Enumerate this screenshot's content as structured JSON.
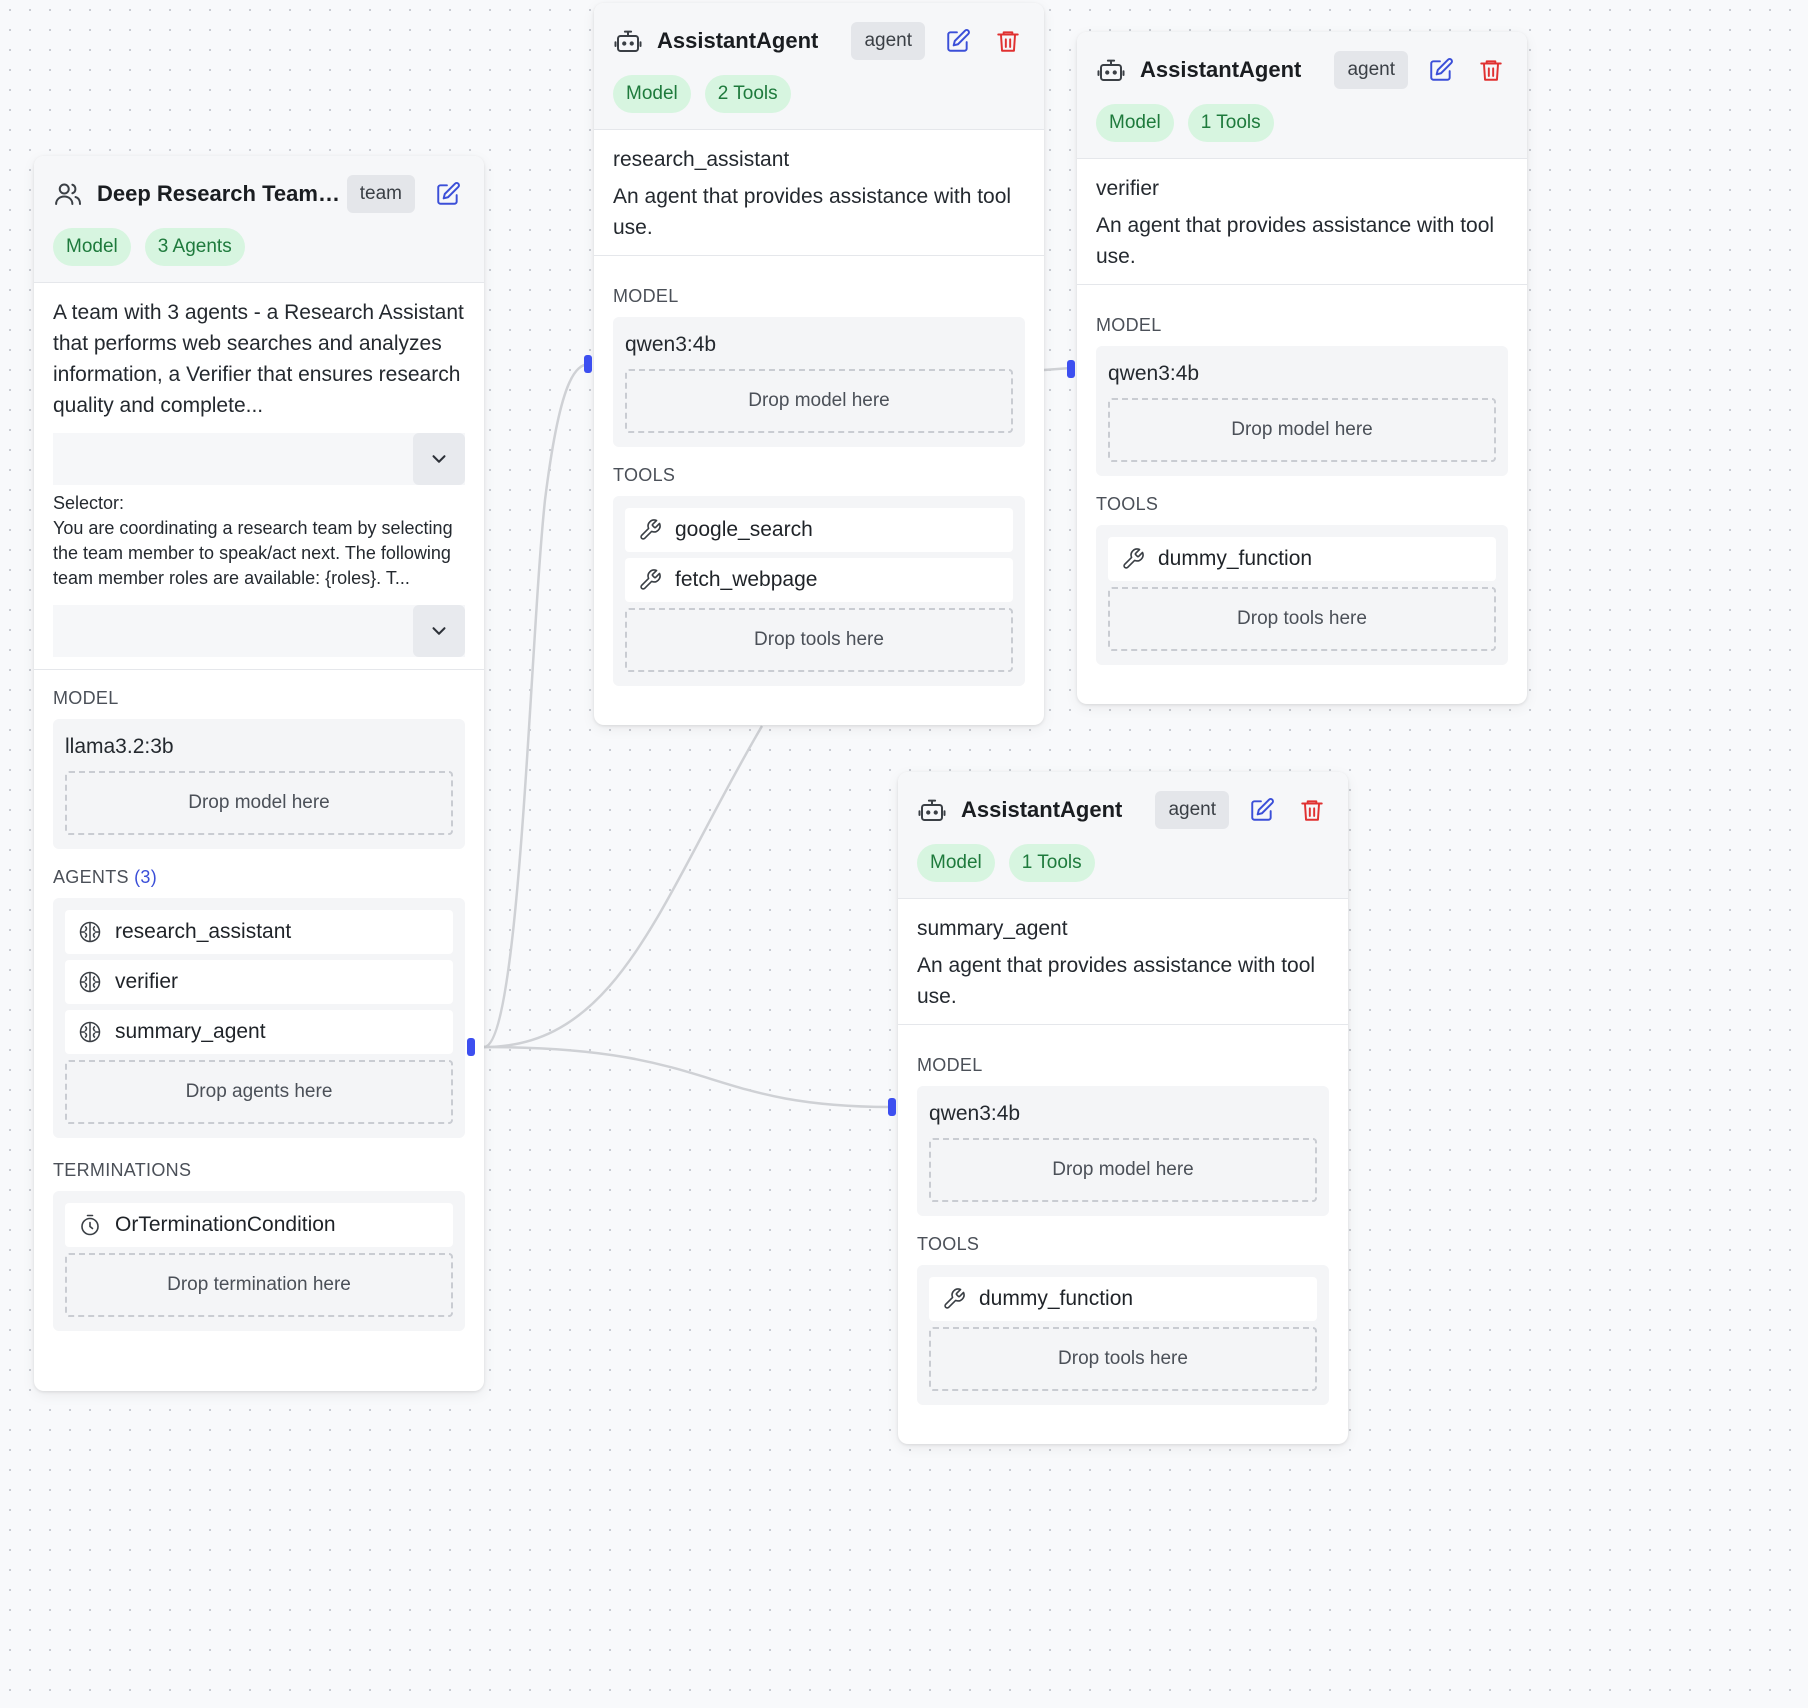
{
  "team": {
    "title": "Deep Research Team_...",
    "type_badge": "team",
    "pills": [
      "Model",
      "3 Agents"
    ],
    "description": "A team with 3 agents - a Research Assistant that performs web searches and analyzes information, a Verifier that ensures research quality and complete...",
    "selector_label": "Selector:",
    "selector_text": "You are coordinating a research team by selecting the team member to speak/act next. The following team member roles are available: {roles}. T...",
    "model_label": "MODEL",
    "model_value": "llama3.2:3b",
    "drop_model": "Drop model here",
    "agents_label": "AGENTS",
    "agents_count": "(3)",
    "agents": [
      "research_assistant",
      "verifier",
      "summary_agent"
    ],
    "drop_agents": "Drop agents here",
    "terminations_label": "TERMINATIONS",
    "termination": "OrTerminationCondition",
    "drop_termination": "Drop termination here"
  },
  "agent1": {
    "title": "AssistantAgent",
    "type_badge": "agent",
    "pills": [
      "Model",
      "2 Tools"
    ],
    "name": "research_assistant",
    "description": "An agent that provides assistance with tool use.",
    "model_label": "MODEL",
    "model_value": "qwen3:4b",
    "drop_model": "Drop model here",
    "tools_label": "TOOLS",
    "tools": [
      "google_search",
      "fetch_webpage"
    ],
    "drop_tools": "Drop tools here"
  },
  "agent2": {
    "title": "AssistantAgent",
    "type_badge": "agent",
    "pills": [
      "Model",
      "1 Tools"
    ],
    "name": "verifier",
    "description": "An agent that provides assistance with tool use.",
    "model_label": "MODEL",
    "model_value": "qwen3:4b",
    "drop_model": "Drop model here",
    "tools_label": "TOOLS",
    "tools": [
      "dummy_function"
    ],
    "drop_tools": "Drop tools here"
  },
  "agent3": {
    "title": "AssistantAgent",
    "type_badge": "agent",
    "pills": [
      "Model",
      "1 Tools"
    ],
    "name": "summary_agent",
    "description": "An agent that provides assistance with tool use.",
    "model_label": "MODEL",
    "model_value": "qwen3:4b",
    "drop_model": "Drop model here",
    "tools_label": "TOOLS",
    "tools": [
      "dummy_function"
    ],
    "drop_tools": "Drop tools here"
  },
  "icons": {
    "team": "users-icon",
    "agent": "robot-icon",
    "edit": "edit-icon",
    "delete": "trash-icon",
    "expand": "chevron-down-icon",
    "agent_item": "brain-icon",
    "tool_item": "wrench-icon",
    "termination_item": "timer-icon"
  },
  "colors": {
    "edit_icon": "#3b4fd8",
    "delete_icon": "#e03131",
    "pill_bg": "#d7f5e0",
    "pill_text": "#1e7a3c",
    "handle": "#3d4ff0",
    "agents_count": "#3b4fd8"
  }
}
